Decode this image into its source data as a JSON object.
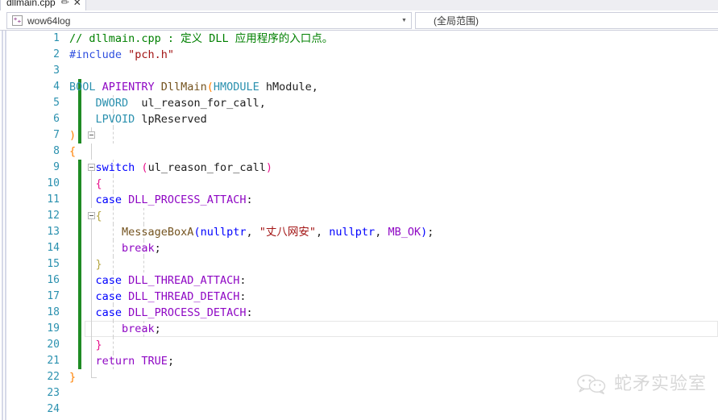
{
  "tab": {
    "label": "dllmain.cpp",
    "pin_icon": "pin-icon",
    "close_icon": "close-icon",
    "close_glyph": "✕",
    "pin_glyph": "✐"
  },
  "navbar": {
    "project_combo": {
      "value": "wow64log",
      "icon": "cpp-project-icon",
      "icon_glyph": "⁺₊",
      "arrow_glyph": "▼"
    },
    "scope_combo": {
      "value": "(全局范围)",
      "arrow_glyph": "▼"
    }
  },
  "editor": {
    "current_line": 19,
    "lines": [
      {
        "n": 1,
        "changed": false,
        "tokens": [
          {
            "t": "// dllmain.cpp : 定义 DLL 应用程序的入口点。",
            "c": "t-cmt"
          }
        ]
      },
      {
        "n": 2,
        "changed": false,
        "tokens": [
          {
            "t": "#include ",
            "c": "t-pre"
          },
          {
            "t": "\"pch.h\"",
            "c": "t-str"
          }
        ]
      },
      {
        "n": 3,
        "changed": false,
        "tokens": []
      },
      {
        "n": 4,
        "changed": true,
        "tokens": [
          {
            "t": "BOOL ",
            "c": "t-kw"
          },
          {
            "t": "APIENTRY ",
            "c": "t-macro"
          },
          {
            "t": "DllMain",
            "c": "t-fn"
          },
          {
            "t": "(",
            "c": "t-paren"
          },
          {
            "t": "HMODULE ",
            "c": "t-kw"
          },
          {
            "t": "hModule",
            "c": "t-id"
          },
          {
            "t": ",",
            "c": "t-punct"
          }
        ]
      },
      {
        "n": 5,
        "changed": true,
        "tokens": [
          {
            "t": "    ",
            "c": "t-id"
          },
          {
            "t": "DWORD ",
            "c": "t-kw"
          },
          {
            "t": " ul_reason_for_call",
            "c": "t-id"
          },
          {
            "t": ",",
            "c": "t-punct"
          }
        ]
      },
      {
        "n": 6,
        "changed": true,
        "tokens": [
          {
            "t": "    ",
            "c": "t-id"
          },
          {
            "t": "LPVOID ",
            "c": "t-kw"
          },
          {
            "t": "lpReserved",
            "c": "t-id"
          }
        ]
      },
      {
        "n": 7,
        "changed": true,
        "tokens": [
          {
            "t": ")",
            "c": "t-paren"
          }
        ]
      },
      {
        "n": 8,
        "changed": false,
        "tokens": [
          {
            "t": "{",
            "c": "t-brace"
          }
        ]
      },
      {
        "n": 9,
        "changed": true,
        "tokens": [
          {
            "t": "    ",
            "c": "t-id"
          },
          {
            "t": "switch ",
            "c": "t-kw2"
          },
          {
            "t": "(",
            "c": "t-hl"
          },
          {
            "t": "ul_reason_for_call",
            "c": "t-id"
          },
          {
            "t": ")",
            "c": "t-hl"
          }
        ]
      },
      {
        "n": 10,
        "changed": true,
        "tokens": [
          {
            "t": "    ",
            "c": "t-id"
          },
          {
            "t": "{",
            "c": "t-hl"
          }
        ]
      },
      {
        "n": 11,
        "changed": true,
        "tokens": [
          {
            "t": "    ",
            "c": "t-id"
          },
          {
            "t": "case ",
            "c": "t-kw2"
          },
          {
            "t": "DLL_PROCESS_ATTACH",
            "c": "t-macro"
          },
          {
            "t": ":",
            "c": "t-punct"
          }
        ]
      },
      {
        "n": 12,
        "changed": true,
        "tokens": [
          {
            "t": "    ",
            "c": "t-id"
          },
          {
            "t": "{",
            "c": "t-brc2"
          }
        ]
      },
      {
        "n": 13,
        "changed": true,
        "tokens": [
          {
            "t": "        ",
            "c": "t-id"
          },
          {
            "t": "MessageBoxA",
            "c": "t-fn"
          },
          {
            "t": "(",
            "c": "t-kw2"
          },
          {
            "t": "nullptr",
            "c": "t-kw2"
          },
          {
            "t": ", ",
            "c": "t-punct"
          },
          {
            "t": "\"丈八网安\"",
            "c": "t-str"
          },
          {
            "t": ", ",
            "c": "t-punct"
          },
          {
            "t": "nullptr",
            "c": "t-kw2"
          },
          {
            "t": ", ",
            "c": "t-punct"
          },
          {
            "t": "MB_OK",
            "c": "t-macro"
          },
          {
            "t": ")",
            "c": "t-kw2"
          },
          {
            "t": ";",
            "c": "t-punct"
          }
        ]
      },
      {
        "n": 14,
        "changed": true,
        "tokens": [
          {
            "t": "        ",
            "c": "t-id"
          },
          {
            "t": "break",
            "c": "t-macro"
          },
          {
            "t": ";",
            "c": "t-punct"
          }
        ]
      },
      {
        "n": 15,
        "changed": true,
        "tokens": [
          {
            "t": "    ",
            "c": "t-id"
          },
          {
            "t": "}",
            "c": "t-brc2"
          }
        ]
      },
      {
        "n": 16,
        "changed": true,
        "tokens": [
          {
            "t": "    ",
            "c": "t-id"
          },
          {
            "t": "case ",
            "c": "t-kw2"
          },
          {
            "t": "DLL_THREAD_ATTACH",
            "c": "t-macro"
          },
          {
            "t": ":",
            "c": "t-punct"
          }
        ]
      },
      {
        "n": 17,
        "changed": true,
        "tokens": [
          {
            "t": "    ",
            "c": "t-id"
          },
          {
            "t": "case ",
            "c": "t-kw2"
          },
          {
            "t": "DLL_THREAD_DETACH",
            "c": "t-macro"
          },
          {
            "t": ":",
            "c": "t-punct"
          }
        ]
      },
      {
        "n": 18,
        "changed": true,
        "tokens": [
          {
            "t": "    ",
            "c": "t-id"
          },
          {
            "t": "case ",
            "c": "t-kw2"
          },
          {
            "t": "DLL_PROCESS_DETACH",
            "c": "t-macro"
          },
          {
            "t": ":",
            "c": "t-punct"
          }
        ]
      },
      {
        "n": 19,
        "changed": true,
        "tokens": [
          {
            "t": "        ",
            "c": "t-id"
          },
          {
            "t": "break",
            "c": "t-macro"
          },
          {
            "t": ";",
            "c": "t-punct"
          }
        ]
      },
      {
        "n": 20,
        "changed": true,
        "tokens": [
          {
            "t": "    ",
            "c": "t-id"
          },
          {
            "t": "}",
            "c": "t-hl"
          }
        ]
      },
      {
        "n": 21,
        "changed": true,
        "tokens": [
          {
            "t": "    ",
            "c": "t-id"
          },
          {
            "t": "return ",
            "c": "t-macro"
          },
          {
            "t": "TRUE",
            "c": "t-macro"
          },
          {
            "t": ";",
            "c": "t-punct"
          }
        ]
      },
      {
        "n": 22,
        "changed": false,
        "tokens": [
          {
            "t": "}",
            "c": "t-brace"
          }
        ]
      },
      {
        "n": 23,
        "changed": false,
        "tokens": []
      },
      {
        "n": 24,
        "changed": false,
        "tokens": []
      }
    ]
  },
  "watermark": {
    "text": "蛇矛实验室",
    "icon": "wechat-icon"
  },
  "colors": {
    "accent": "#0078d7",
    "changebar_green": "#1f8b24",
    "lineno_blue": "#2b91af",
    "comment_green": "#008000",
    "string_red": "#a31515",
    "macro_purple": "#8f08c4",
    "keyword_blue": "#0000ff",
    "function_brown": "#74531f",
    "paren_orange": "#ff8000",
    "highlight_pink": "#e8128c",
    "chrome_border": "#cccedb",
    "tabstrip_bg": "#eeeef2"
  }
}
